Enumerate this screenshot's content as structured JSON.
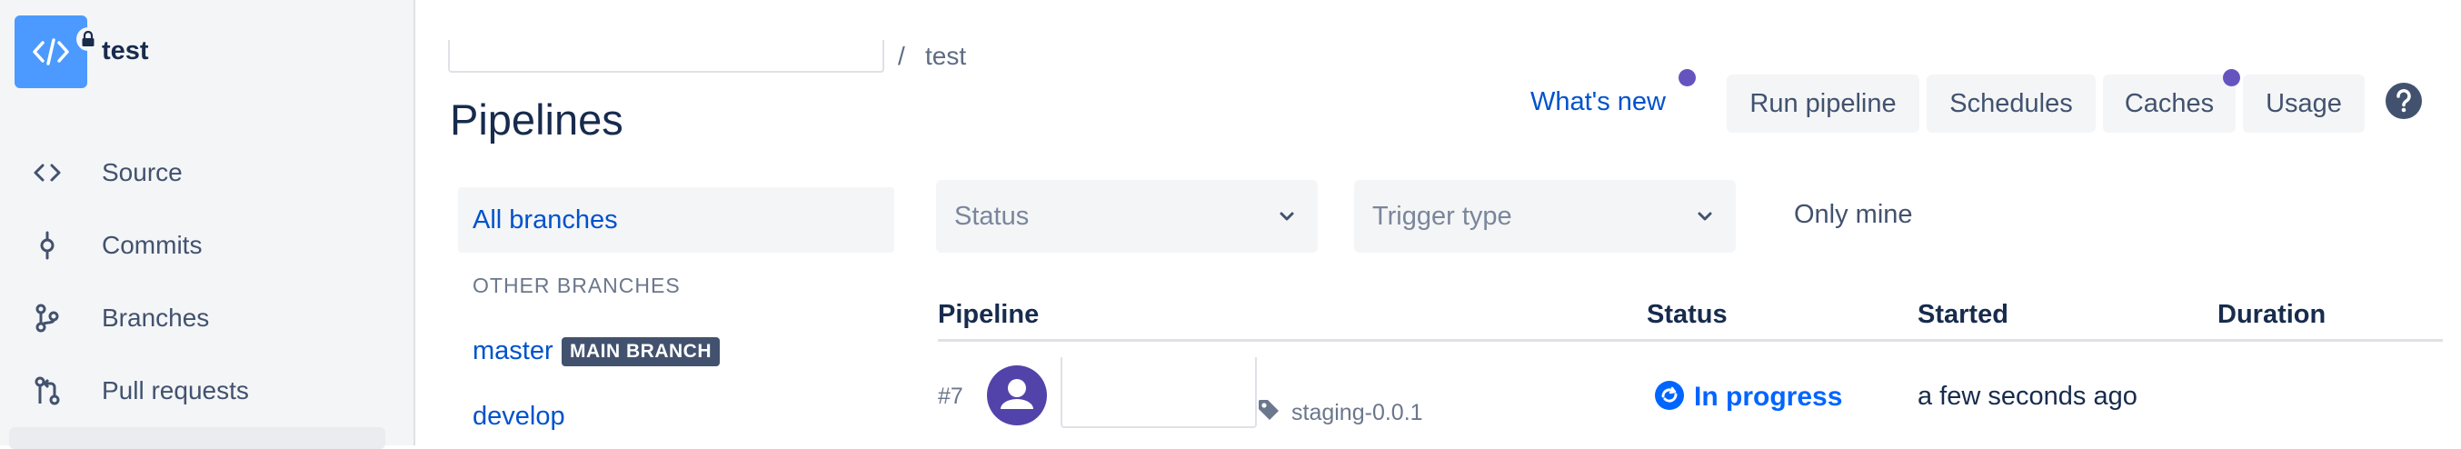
{
  "repo": {
    "name": "test"
  },
  "sidebar": {
    "items": [
      {
        "label": "Source",
        "icon": "code-icon"
      },
      {
        "label": "Commits",
        "icon": "commit-icon"
      },
      {
        "label": "Branches",
        "icon": "branch-icon"
      },
      {
        "label": "Pull requests",
        "icon": "pull-request-icon"
      }
    ]
  },
  "breadcrumb": {
    "separator": "/",
    "current": "test"
  },
  "page": {
    "title": "Pipelines"
  },
  "header": {
    "whats_new": "What's new",
    "buttons": {
      "run_pipeline": "Run pipeline",
      "schedules": "Schedules",
      "caches": "Caches",
      "usage": "Usage"
    }
  },
  "branches": {
    "all": "All branches",
    "other_heading": "OTHER BRANCHES",
    "items": [
      {
        "name": "master",
        "badge": "MAIN BRANCH"
      },
      {
        "name": "develop"
      }
    ]
  },
  "filters": {
    "status_placeholder": "Status",
    "trigger_placeholder": "Trigger type",
    "only_mine": "Only mine"
  },
  "table": {
    "headers": [
      "Pipeline",
      "Status",
      "Started",
      "Duration"
    ],
    "rows": [
      {
        "number": "#7",
        "tag": "staging-0.0.1",
        "status": "In progress",
        "started": "a few seconds ago",
        "duration": ""
      }
    ]
  },
  "colors": {
    "accent": "#0052CC",
    "in_progress": "#0065FF",
    "notification_dot": "#6554C0",
    "repo_avatar": "#4C9AFF"
  }
}
